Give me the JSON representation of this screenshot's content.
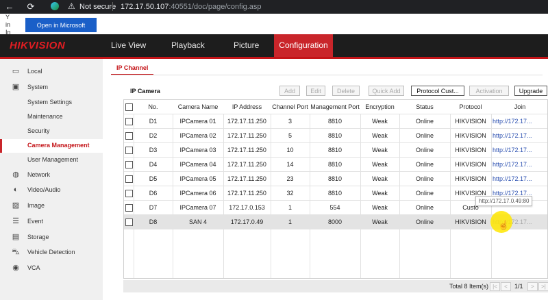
{
  "browser": {
    "back": "←",
    "reload": "⟳",
    "security": "Not secure",
    "url_host": "172.17.50.107",
    "url_path": ":40551/doc/page/config.asp",
    "edge_button": "Open in Microsoft Edge",
    "side_letters": [
      "Y",
      "in",
      "In"
    ]
  },
  "header": {
    "logo": "HIKVISION",
    "tabs": [
      "Live View",
      "Playback",
      "Picture",
      "Configuration"
    ],
    "active_tab": "Configuration",
    "accent": "#c9252a"
  },
  "sidebar": {
    "items": [
      {
        "label": "Local",
        "icon": "monitor-icon"
      },
      {
        "label": "System",
        "icon": "system-icon"
      },
      {
        "label": "System Settings",
        "icon": ""
      },
      {
        "label": "Maintenance",
        "icon": ""
      },
      {
        "label": "Security",
        "icon": ""
      },
      {
        "label": "Camera Management",
        "icon": ""
      },
      {
        "label": "User Management",
        "icon": ""
      },
      {
        "label": "Network",
        "icon": "globe-icon"
      },
      {
        "label": "Video/Audio",
        "icon": "video-audio-icon"
      },
      {
        "label": "Image",
        "icon": "image-icon"
      },
      {
        "label": "Event",
        "icon": "event-icon"
      },
      {
        "label": "Storage",
        "icon": "storage-icon"
      },
      {
        "label": "Vehicle Detection",
        "icon": "vehicle-icon"
      },
      {
        "label": "VCA",
        "icon": "vca-icon"
      }
    ],
    "active": "Camera Management"
  },
  "content": {
    "tab": "IP Channel",
    "section_title": "IP Camera",
    "buttons": [
      {
        "label": "Add",
        "enabled": false
      },
      {
        "label": "Edit",
        "enabled": false
      },
      {
        "label": "Delete",
        "enabled": false
      },
      {
        "label": "Quick Add",
        "enabled": false
      },
      {
        "label": "Protocol Cust...",
        "enabled": true
      },
      {
        "label": "Activation",
        "enabled": false
      },
      {
        "label": "Upgrade",
        "enabled": true
      }
    ],
    "columns": [
      "No.",
      "Camera Name",
      "IP Address",
      "Channel Port",
      "Management Port",
      "Encryption",
      "Status",
      "Protocol",
      "Join"
    ],
    "rows": [
      [
        "D1",
        "IPCamera 01",
        "172.17.11.250",
        "3",
        "8810",
        "Weak",
        "Online",
        "HIKVISION",
        "http://172.17..."
      ],
      [
        "D2",
        "IPCamera 02",
        "172.17.11.250",
        "5",
        "8810",
        "Weak",
        "Online",
        "HIKVISION",
        "http://172.17..."
      ],
      [
        "D3",
        "IPCamera 03",
        "172.17.11.250",
        "10",
        "8810",
        "Weak",
        "Online",
        "HIKVISION",
        "http://172.17..."
      ],
      [
        "D4",
        "IPCamera 04",
        "172.17.11.250",
        "14",
        "8810",
        "Weak",
        "Online",
        "HIKVISION",
        "http://172.17..."
      ],
      [
        "D5",
        "IPCamera 05",
        "172.17.11.250",
        "23",
        "8810",
        "Weak",
        "Online",
        "HIKVISION",
        "http://172.17..."
      ],
      [
        "D6",
        "IPCamera 06",
        "172.17.11.250",
        "32",
        "8810",
        "Weak",
        "Online",
        "HIKVISION",
        "http://172.17..."
      ],
      [
        "D7",
        "IPCamera 07",
        "172.17.0.153",
        "1",
        "554",
        "Weak",
        "Online",
        "Custo",
        ""
      ],
      [
        "D8",
        "SAN 4",
        "172.17.0.49",
        "1",
        "8000",
        "Weak",
        "Online",
        "HIKVISION",
        "http://172.17..."
      ]
    ],
    "selected_row": 7,
    "tooltip": "http://172.17.0.49:80",
    "footer": {
      "total": "Total 8 Item(s)",
      "page": "1/1",
      "first": "|<",
      "prev": "<",
      "next": ">",
      "last": ">|"
    }
  }
}
